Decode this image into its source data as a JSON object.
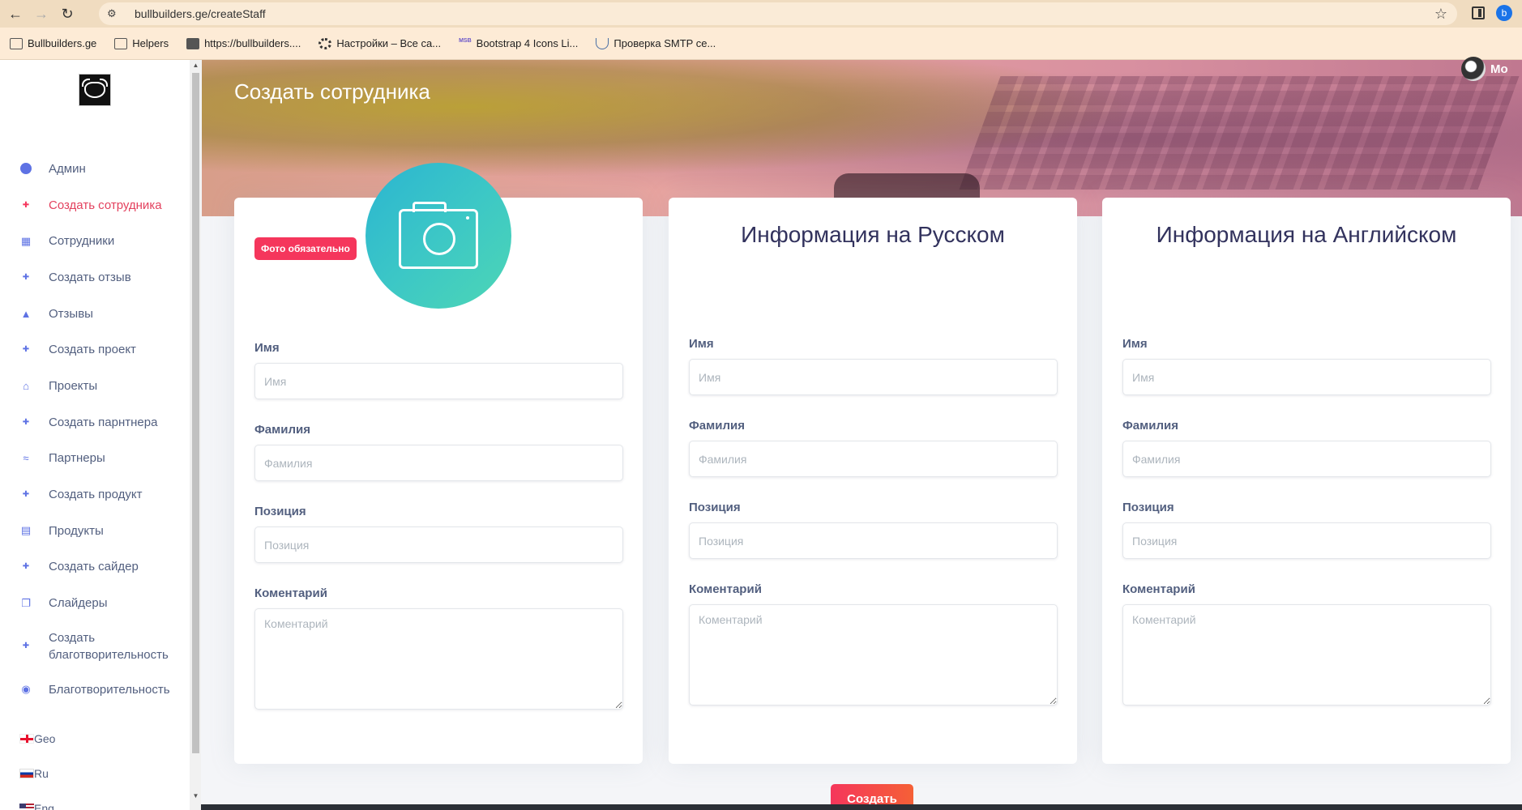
{
  "browser": {
    "url": "bullbuilders.ge/createStaff",
    "profile_initial": "b",
    "bookmarks": [
      {
        "label": "Bullbuilders.ge",
        "icon": "folder-icon"
      },
      {
        "label": "Helpers",
        "icon": "folder-icon"
      },
      {
        "label": "https://bullbuilders....",
        "icon": "site-favicon-icon"
      },
      {
        "label": "Настройки – Все са...",
        "icon": "gear-icon"
      },
      {
        "label": "Bootstrap 4 Icons Li...",
        "icon": "msb-icon",
        "icon_text": "MSB"
      },
      {
        "label": "Проверка SMTP се...",
        "icon": "stethoscope-icon"
      }
    ]
  },
  "sidebar": {
    "items": [
      {
        "label": "Админ",
        "icon": "user-circle-icon",
        "active": false
      },
      {
        "label": "Создать сотрудника",
        "icon": "plus-icon",
        "active": true
      },
      {
        "label": "Сотрудники",
        "icon": "id-badge-icon",
        "active": false
      },
      {
        "label": "Создать отзыв",
        "icon": "plus-icon",
        "active": false
      },
      {
        "label": "Отзывы",
        "icon": "thumbs-up-icon",
        "active": false
      },
      {
        "label": "Создать проект",
        "icon": "plus-icon",
        "active": false
      },
      {
        "label": "Проекты",
        "icon": "store-icon",
        "active": false
      },
      {
        "label": "Создать парнтнера",
        "icon": "plus-icon",
        "active": false
      },
      {
        "label": "Партнеры",
        "icon": "handshake-icon",
        "active": false
      },
      {
        "label": "Создать продукт",
        "icon": "plus-icon",
        "active": false
      },
      {
        "label": "Продукты",
        "icon": "clipboard-icon",
        "active": false
      },
      {
        "label": "Создать сайдер",
        "icon": "plus-icon",
        "active": false
      },
      {
        "label": "Слайдеры",
        "icon": "copy-icon",
        "active": false
      },
      {
        "label": "Создать благотворительность",
        "icon": "plus-icon",
        "active": false
      },
      {
        "label": "Благотворительность",
        "icon": "donate-icon",
        "active": false
      }
    ],
    "languages": [
      {
        "label": "Geo",
        "flag": "georgia-flag-icon"
      },
      {
        "label": "Ru",
        "flag": "russia-flag-icon"
      },
      {
        "label": "Eng",
        "flag": "usa-flag-icon"
      }
    ]
  },
  "header": {
    "title": "Создать сотрудника",
    "user_name": "Mo"
  },
  "photo_card": {
    "badge": "Фото обязательно",
    "fields": {
      "first_name": {
        "label": "Имя",
        "placeholder": "Имя"
      },
      "last_name": {
        "label": "Фамилия",
        "placeholder": "Фамилия"
      },
      "position": {
        "label": "Позиция",
        "placeholder": "Позиция"
      },
      "comment": {
        "label": "Коментарий",
        "placeholder": "Коментарий"
      }
    }
  },
  "ru_card": {
    "title": "Информация на Русском",
    "fields": {
      "first_name": {
        "label": "Имя",
        "placeholder": "Имя"
      },
      "last_name": {
        "label": "Фамилия",
        "placeholder": "Фамилия"
      },
      "position": {
        "label": "Позиция",
        "placeholder": "Позиция"
      },
      "comment": {
        "label": "Коментарий",
        "placeholder": "Коментарий"
      }
    }
  },
  "en_card": {
    "title": "Информация на Английском",
    "fields": {
      "first_name": {
        "label": "Имя",
        "placeholder": "Имя"
      },
      "last_name": {
        "label": "Фамилия",
        "placeholder": "Фамилия"
      },
      "position": {
        "label": "Позиция",
        "placeholder": "Позиция"
      },
      "comment": {
        "label": "Коментарий",
        "placeholder": "Коментарий"
      }
    }
  },
  "actions": {
    "submit_label": "Создать"
  },
  "colors": {
    "accent": "#f5365c",
    "nav_icon": "#5e72e4",
    "camera_gradient_start": "#2bb5d1",
    "camera_gradient_end": "#4dd6b5"
  }
}
